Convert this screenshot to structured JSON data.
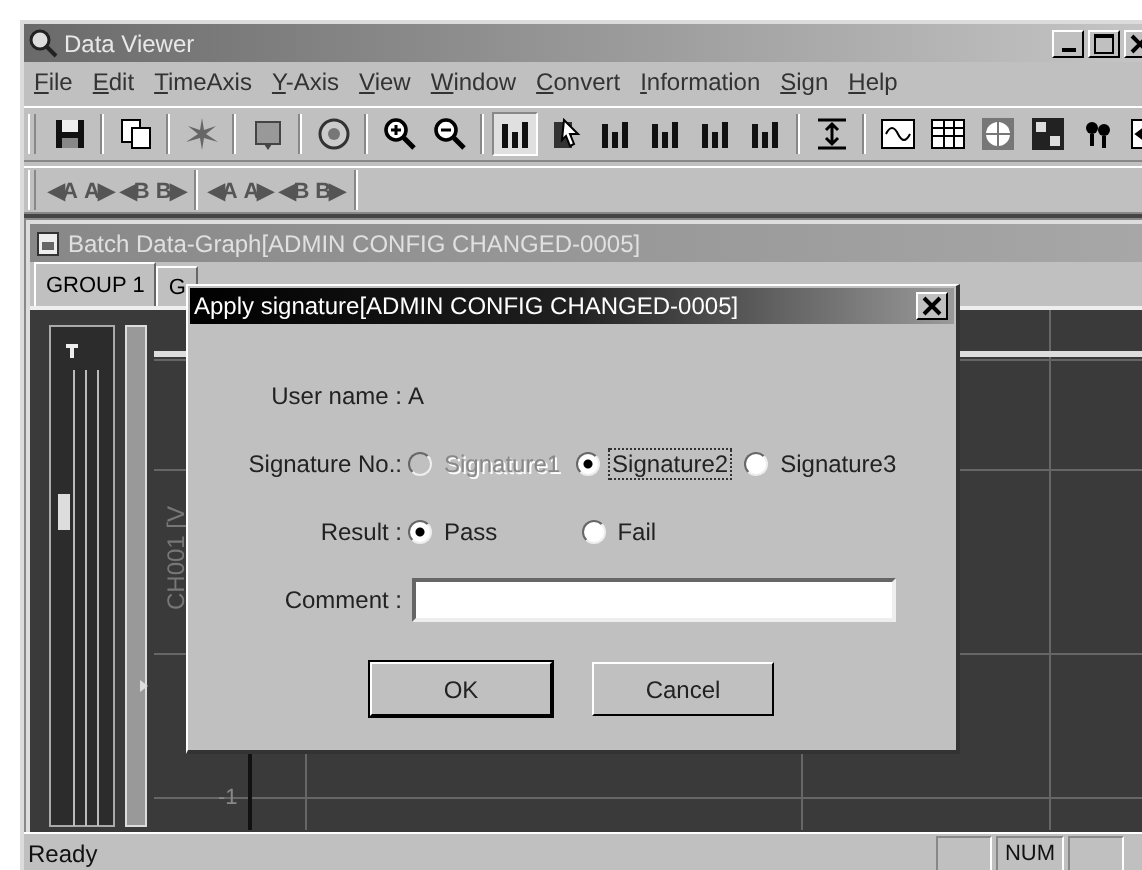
{
  "window": {
    "title": "Data Viewer"
  },
  "menu": [
    "File",
    "Edit",
    "TimeAxis",
    "Y-Axis",
    "View",
    "Window",
    "Convert",
    "Information",
    "Sign",
    "Help"
  ],
  "marker_toolbar": [
    [
      "◀A",
      "A▶",
      "◀B",
      "B▶"
    ],
    [
      "◀A",
      "A▶",
      "◀B",
      "B▶"
    ]
  ],
  "document": {
    "title": "Batch Data-Graph[ADMIN CONFIG CHANGED-0005]",
    "tabs": [
      {
        "label": "GROUP 1",
        "selected": true
      },
      {
        "label": "G",
        "selected": false
      }
    ],
    "axis_label": "CH001 [V",
    "tick": "-1"
  },
  "dialog": {
    "title": "Apply signature[ADMIN CONFIG CHANGED-0005]",
    "user_label": "User name :",
    "user_value": "A",
    "signature_label": "Signature No.:",
    "signatures": [
      {
        "label": "Signature1",
        "selected": false,
        "disabled": true
      },
      {
        "label": "Signature2",
        "selected": true,
        "disabled": false
      },
      {
        "label": "Signature3",
        "selected": false,
        "disabled": false
      }
    ],
    "result_label": "Result :",
    "results": [
      {
        "label": "Pass",
        "selected": true
      },
      {
        "label": "Fail",
        "selected": false
      }
    ],
    "comment_label": "Comment :",
    "buttons": [
      "OK",
      "Cancel"
    ]
  },
  "status_bar": {
    "text": "Ready",
    "indicators": [
      "NUM"
    ]
  }
}
